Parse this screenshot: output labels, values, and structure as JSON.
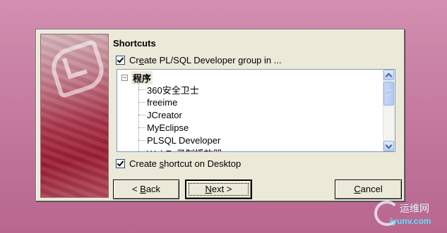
{
  "dialog": {
    "heading": "Shortcuts",
    "create_group": {
      "label_pre": "Cr",
      "label_mnemonic": "e",
      "label_post": "ate PL/SQL Developer group in ...",
      "checked": true
    },
    "tree": {
      "root": "程序",
      "items": [
        "360安全卫士",
        "freeime",
        "JCreator",
        "MyEclipse",
        "PLSQL Developer",
        "WebEx录制播放器"
      ]
    },
    "create_desktop": {
      "label_pre": "Create ",
      "label_mnemonic": "s",
      "label_post": "hortcut on Desktop",
      "checked": true
    },
    "buttons": {
      "back": {
        "arrow": "<",
        "mnemonic": "B",
        "rest": "ack"
      },
      "next": {
        "mnemonic": "N",
        "rest": "ext",
        "arrow": ">"
      },
      "cancel": {
        "mnemonic": "C",
        "rest": "ancel"
      }
    }
  },
  "watermark": {
    "cn": "运维网",
    "url": "iyunv.com"
  }
}
